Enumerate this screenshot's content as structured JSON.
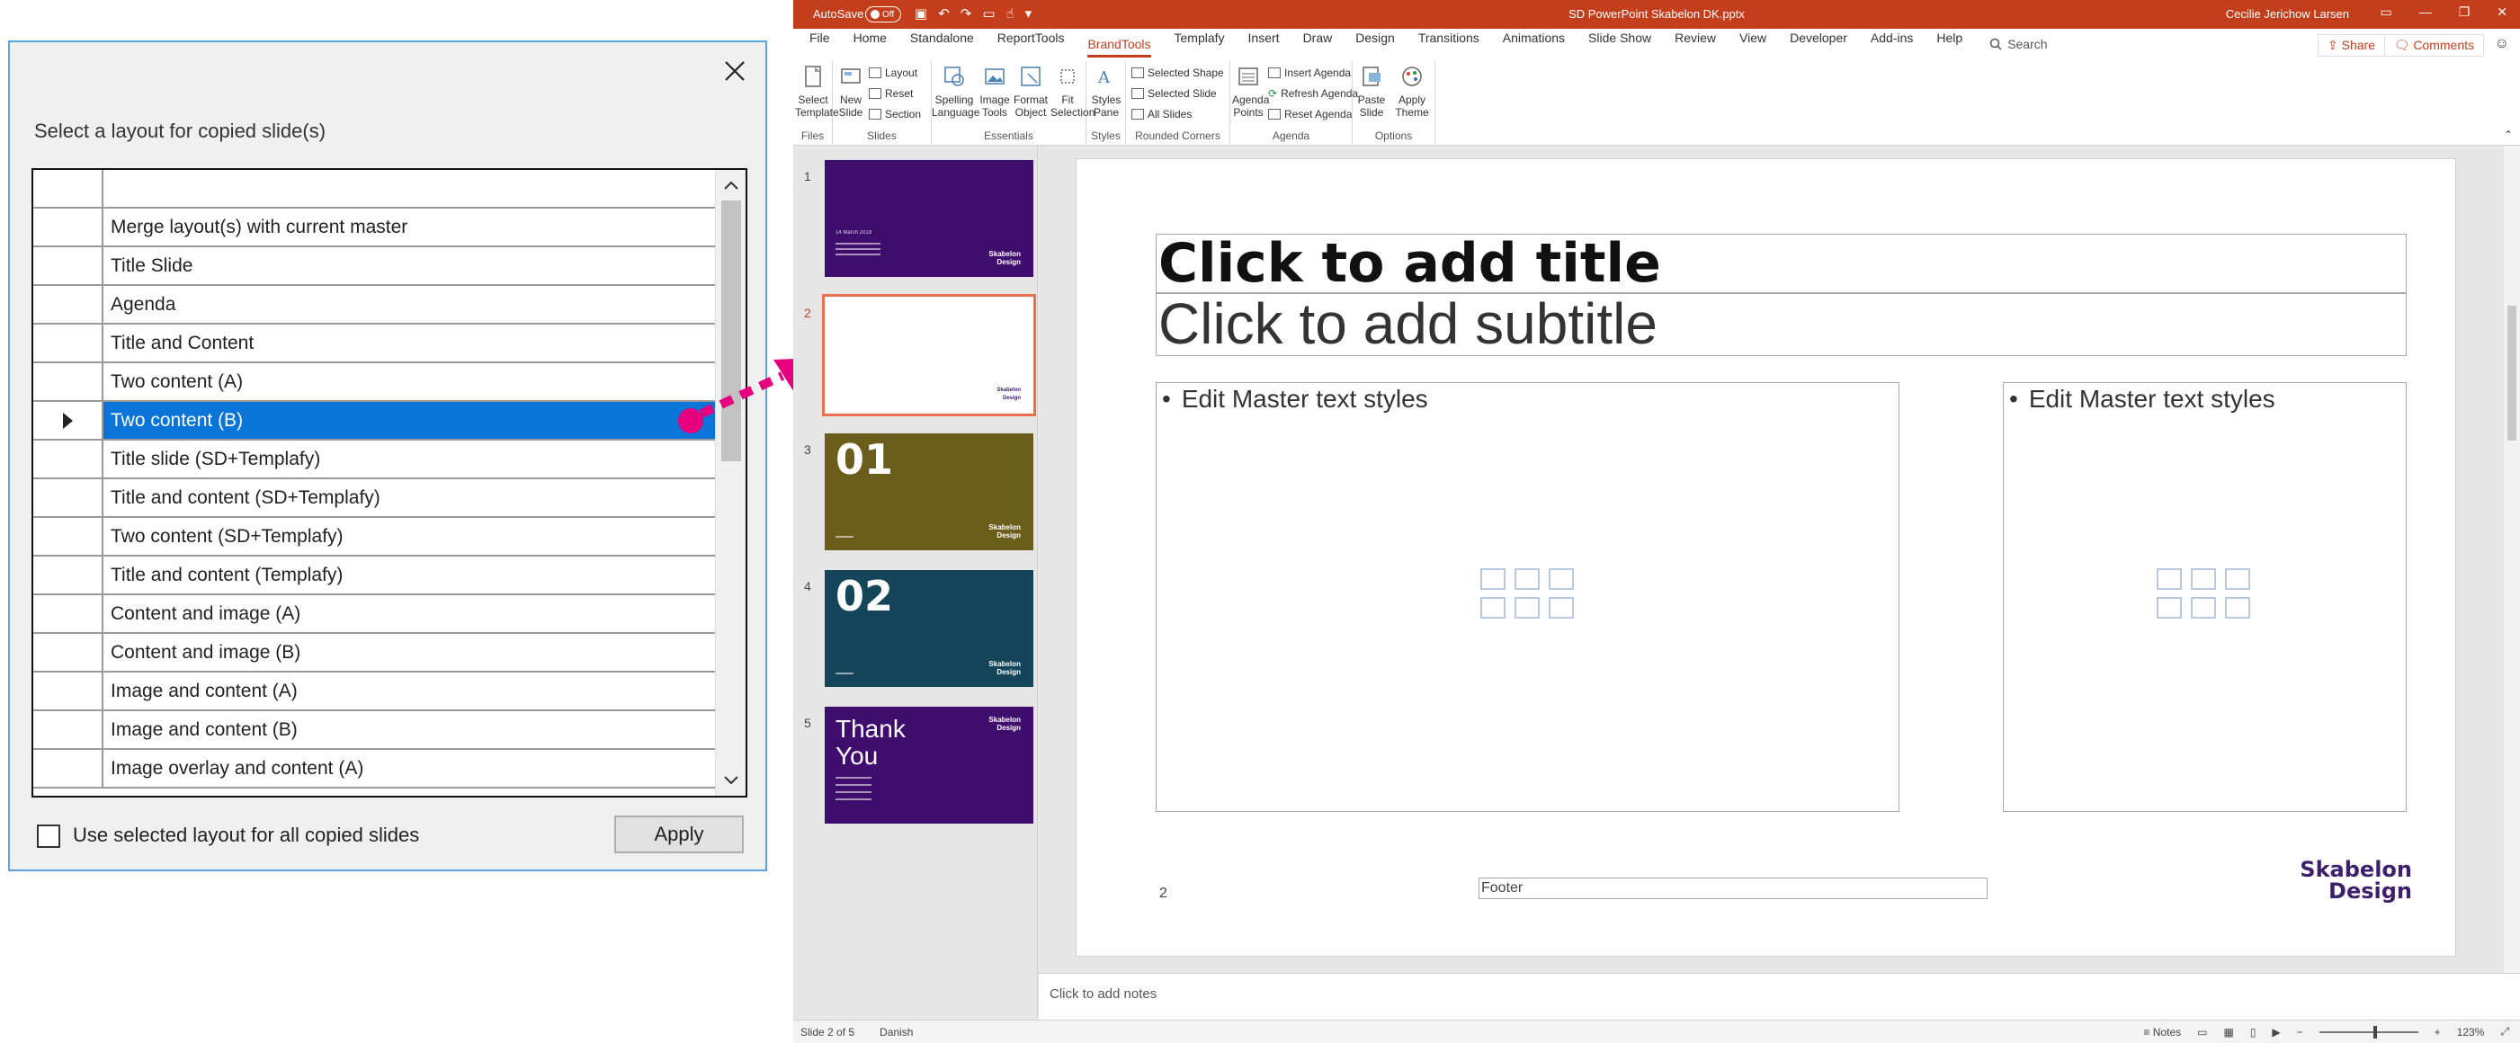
{
  "dialog": {
    "prompt": "Select a layout for copied slide(s)",
    "rows": [
      "Merge layout(s) with current master",
      "Title Slide",
      "Agenda",
      "Title and Content",
      "Two content (A)",
      "Two content (B)",
      "Title slide (SD+Templafy)",
      "Title and content (SD+Templafy)",
      "Two content (SD+Templafy)",
      "Title and content (Templafy)",
      "Content and image (A)",
      "Content and image (B)",
      "Image and content (A)",
      "Image and content (B)",
      "Image overlay and content (A)"
    ],
    "selected_index": 5,
    "checkbox_label": "Use selected layout for all copied slides",
    "apply_label": "Apply"
  },
  "ppt": {
    "titlebar": {
      "autosave": "AutoSave",
      "autosave_state": "Off",
      "document": "SD PowerPoint Skabelon DK.pptx",
      "user": "Cecilie Jerichow Larsen"
    },
    "menu": [
      "File",
      "Home",
      "Standalone",
      "ReportTools",
      "BrandTools",
      "Templafy",
      "Insert",
      "Draw",
      "Design",
      "Transitions",
      "Animations",
      "Slide Show",
      "Review",
      "View",
      "Developer",
      "Add-ins",
      "Help"
    ],
    "active_menu_index": 4,
    "search_label": "Search",
    "share_label": "Share",
    "comments_label": "Comments",
    "ribbon": {
      "files": {
        "label": "Files",
        "select_template": "Select Template"
      },
      "slides": {
        "label": "Slides",
        "new_slide": "New Slide",
        "layout": "Layout",
        "reset": "Reset",
        "section": "Section"
      },
      "essentials": {
        "label": "Essentials",
        "spelling": "Spelling Language",
        "image_tools": "Image Tools",
        "format_object": "Format Object",
        "fit_selection": "Fit Selection"
      },
      "styles": {
        "label": "Styles",
        "styles_pane": "Styles Pane"
      },
      "rounded": {
        "label": "Rounded Corners",
        "selected_shape": "Selected Shape",
        "selected_slide": "Selected Slide",
        "all_slides": "All Slides"
      },
      "agenda": {
        "label": "Agenda",
        "agenda_points": "Agenda Points",
        "insert_agenda": "Insert Agenda",
        "refresh_agenda": "Refresh Agenda",
        "reset_agenda": "Reset Agenda"
      },
      "options": {
        "label": "Options",
        "paste_slide": "Paste Slide",
        "apply_theme": "Apply Theme"
      }
    },
    "thumbnails": [
      {
        "num": "1",
        "color": "#3f0d6e",
        "big": "",
        "date": "14 March 2019"
      },
      {
        "num": "2",
        "color": "#ffffff",
        "big": ""
      },
      {
        "num": "3",
        "color": "#6b5e1c",
        "big": "01"
      },
      {
        "num": "4",
        "color": "#144559",
        "big": "02"
      },
      {
        "num": "5",
        "color": "#3f0d6e",
        "big": "Thank You"
      }
    ],
    "thumb_logo": "Skabelon Design",
    "slide": {
      "title": "Click to add title",
      "subtitle": "Click to add subtitle",
      "left_body": "Edit Master text styles",
      "right_body": "Edit Master text styles",
      "bullet": "•",
      "page_number": "2",
      "footer": "Footer",
      "brand_line1": "Skabelon",
      "brand_line2": "Design"
    },
    "notes": "Click to add notes",
    "status": {
      "slide_of": "Slide 2 of 5",
      "language": "Danish",
      "notes": "Notes",
      "zoom": "123%"
    }
  }
}
